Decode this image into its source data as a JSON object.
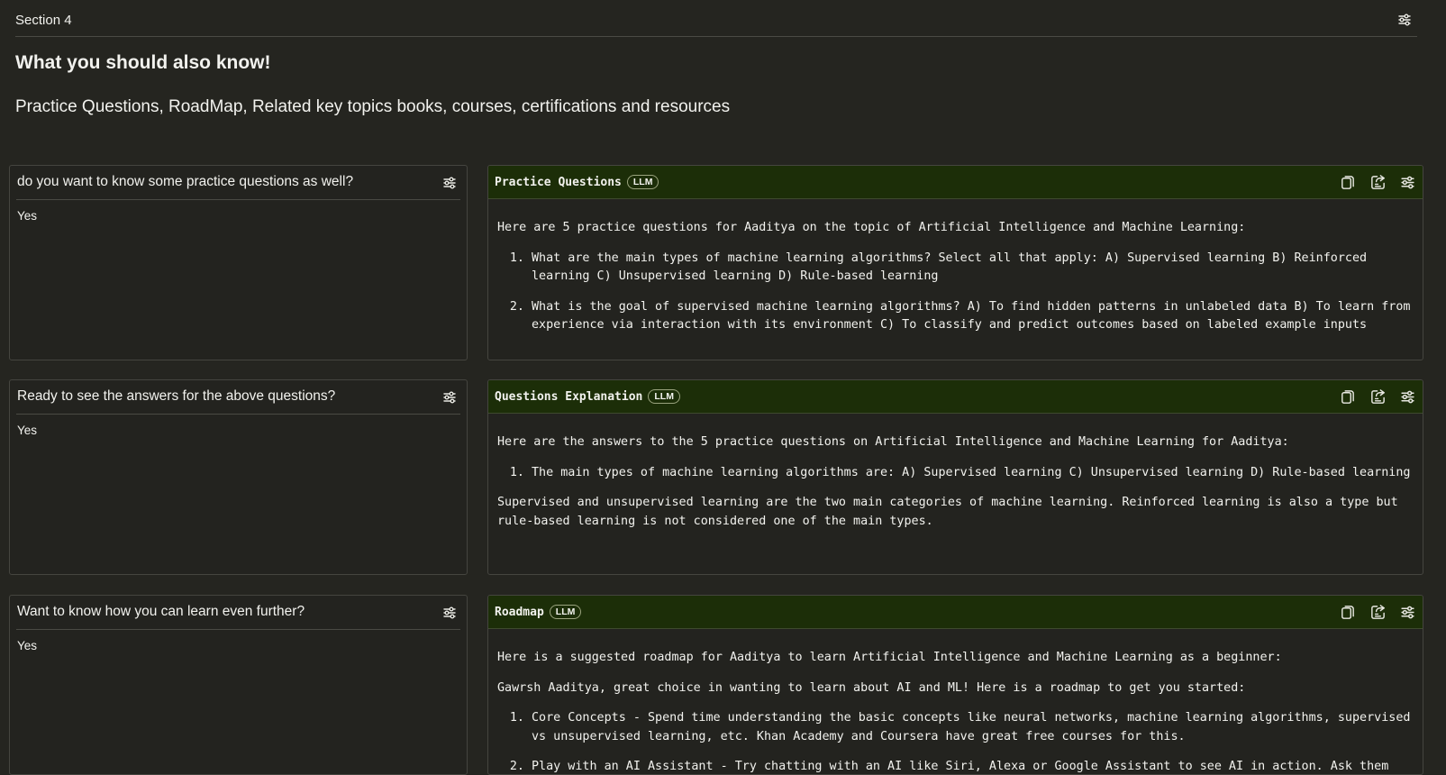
{
  "section": {
    "title": "Section 4"
  },
  "heading": "What you should also know!",
  "subheading": "Practice Questions, RoadMap, Related key topics books, courses, certifications and resources",
  "rows": [
    {
      "question": {
        "label": "do you want to know some practice questions as well?",
        "value": "Yes"
      },
      "output": {
        "title": "Practice Questions",
        "badge": "LLM",
        "intro": "Here are 5 practice questions for Aaditya on the topic of Artificial Intelligence and Machine Learning:",
        "items": [
          "What are the main types of machine learning algorithms? Select all that apply: A) Supervised learning B) Reinforced learning C) Unsupervised learning D) Rule-based learning",
          "What is the goal of supervised machine learning algorithms? A) To find hidden patterns in unlabeled data B) To learn from experience via interaction with its environment C) To classify and predict outcomes based on labeled example inputs"
        ]
      }
    },
    {
      "question": {
        "label": "Ready to see the answers for the above questions?",
        "value": "Yes"
      },
      "output": {
        "title": "Questions Explanation",
        "badge": "LLM",
        "intro": "Here are the answers to the 5 practice questions on Artificial Intelligence and Machine Learning for Aaditya:",
        "items": [
          "The main types of machine learning algorithms are: A) Supervised learning C) Unsupervised learning D) Rule-based learning"
        ],
        "after": "Supervised and unsupervised learning are the two main categories of machine learning. Reinforced learning is also a type but rule-based learning is not considered one of the main types."
      }
    },
    {
      "question": {
        "label": "Want to know how you can learn even further?",
        "value": "Yes"
      },
      "output": {
        "title": "Roadmap",
        "badge": "LLM",
        "intro": "Here is a suggested roadmap for Aaditya to learn Artificial Intelligence and Machine Learning as a beginner:",
        "intro2": "Gawrsh Aaditya, great choice in wanting to learn about AI and ML! Here is a roadmap to get you started:",
        "items": [
          "Core Concepts - Spend time understanding the basic concepts like neural networks, machine learning algorithms, supervised vs unsupervised learning, etc. Khan Academy and Coursera have great free courses for this.",
          "Play with an AI Assistant - Try chatting with an AI like Siri, Alexa or Google Assistant to see AI in action. Ask them questions and see how they respond."
        ]
      }
    }
  ],
  "icons": {
    "settings": "sliders-icon",
    "copy": "copy-icon",
    "share": "share-icon"
  },
  "colors": {
    "background": "#252520",
    "header_green": "#1c2e08",
    "border": "#45453f",
    "text": "#f2f2ee"
  }
}
